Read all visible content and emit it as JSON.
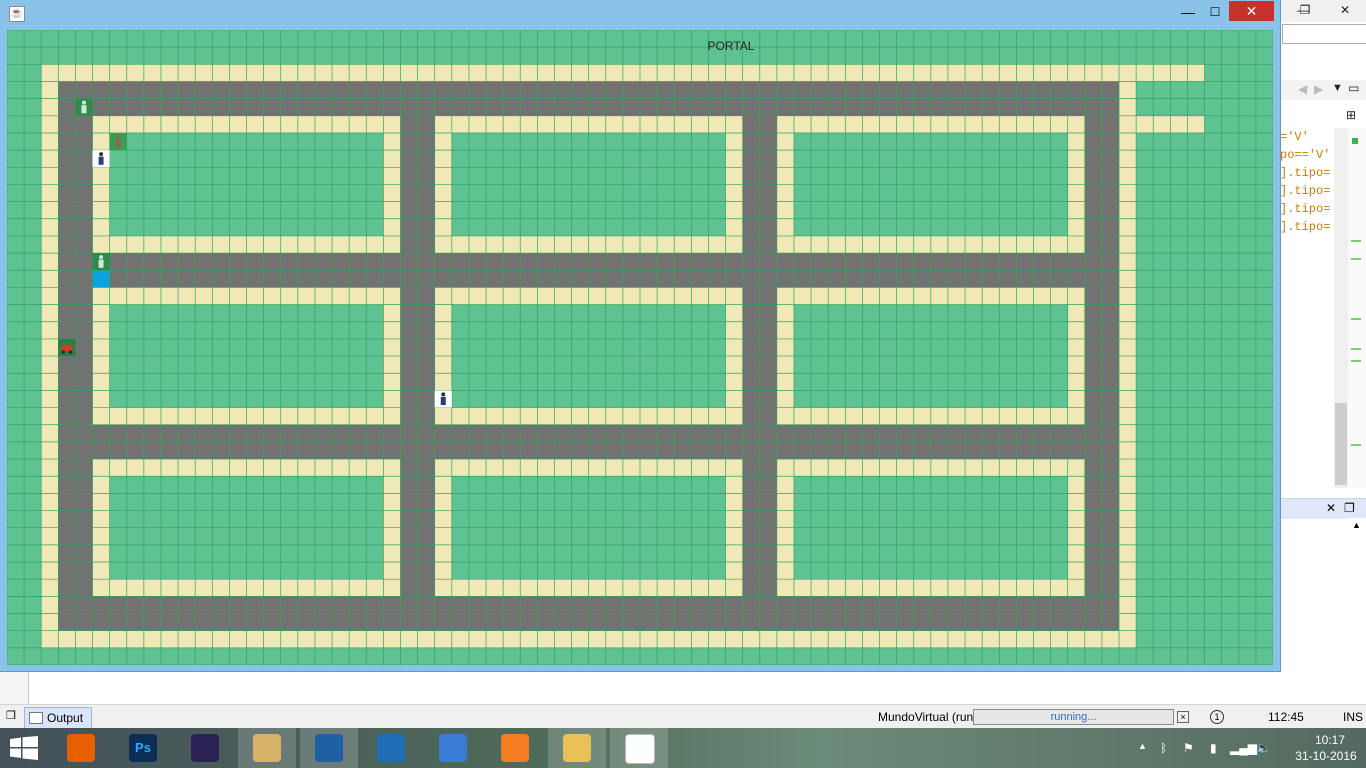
{
  "game_window": {
    "title": "",
    "map_label": "PORTAL",
    "controls": {
      "minimize": "—",
      "maximize": "☐",
      "close": "✕"
    }
  },
  "colors": {
    "grass": "#5fc293",
    "grid_line": "#2fa45c",
    "sidewalk": "#f0e8b6",
    "road": "#727272",
    "vehicle_blue": "#0aa2e0",
    "close_red": "#c7302b"
  },
  "editor": {
    "lines": [
      {
        "text": "='V'"
      },
      {
        "text": "po=='V'"
      },
      {
        "text": "].tipo="
      },
      {
        "text": "].tipo="
      },
      {
        "text": "].tipo="
      },
      {
        "text": "].tipo="
      }
    ]
  },
  "statusbar": {
    "output_tab": "Output",
    "run_label": "MundoVirtual (run)",
    "progress_text": "running...",
    "notifications": "1",
    "caret_position": "112:45",
    "insert_mode": "INS"
  },
  "taskbar": {
    "apps": [
      {
        "name": "Firefox",
        "icon": "firefox-icon",
        "label": ""
      },
      {
        "name": "Photoshop",
        "icon": "photoshop-icon",
        "label": "Ps"
      },
      {
        "name": "Eclipse",
        "icon": "eclipse-icon",
        "label": ""
      },
      {
        "name": "Paint",
        "icon": "paint-icon",
        "label": ""
      },
      {
        "name": "VirtualBox",
        "icon": "virtualbox-icon",
        "label": ""
      },
      {
        "name": "IntelliJ",
        "icon": "bracket-app-icon",
        "label": ""
      },
      {
        "name": "Git",
        "icon": "git-icon",
        "label": ""
      },
      {
        "name": "XAMPP",
        "icon": "xampp-icon",
        "label": ""
      },
      {
        "name": "File Explorer",
        "icon": "folder-icon",
        "label": ""
      },
      {
        "name": "Java",
        "icon": "java-icon",
        "label": ""
      }
    ],
    "clock_time": "10:17",
    "clock_date": "31-10-2016"
  },
  "map": {
    "cols": 74,
    "rows": 37,
    "entities": [
      {
        "kind": "person",
        "icon": "person-green-icon",
        "col": 4,
        "row": 4
      },
      {
        "kind": "person",
        "icon": "person-brown-icon",
        "col": 6,
        "row": 6
      },
      {
        "kind": "pedestrian",
        "icon": "pedestrian-icon",
        "col": 5,
        "row": 7
      },
      {
        "kind": "vehicle",
        "icon": "blue-vehicle-icon",
        "col": 5,
        "row": 13
      },
      {
        "kind": "car",
        "icon": "red-car-icon",
        "col": 3,
        "row": 18
      },
      {
        "kind": "pedestrian",
        "icon": "pedestrian-icon",
        "col": 25,
        "row": 21
      }
    ]
  }
}
